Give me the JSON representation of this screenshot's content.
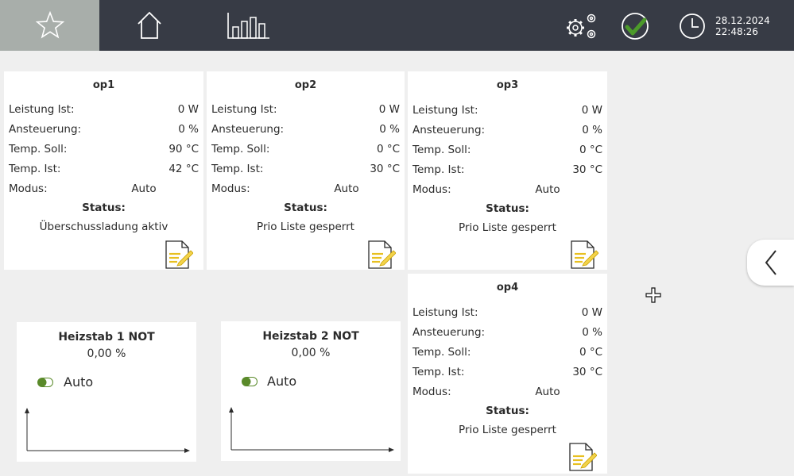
{
  "header": {
    "tabs": [
      {
        "icon": "star-icon",
        "active": true
      },
      {
        "icon": "home-icon",
        "active": false
      },
      {
        "icon": "bar-chart-icon",
        "active": false
      }
    ],
    "date": "28.12.2024",
    "time": "22:48:26",
    "colors": {
      "bar": "#373b45",
      "active_tab": "#a8aeaa",
      "ok_check": "#4c9a2a"
    }
  },
  "labels": {
    "leistung": "Leistung Ist:",
    "ansteuerung": "Ansteuerung:",
    "temp_soll": "Temp. Soll:",
    "temp_ist": "Temp. Ist:",
    "modus": "Modus:",
    "status": "Status:"
  },
  "devices": [
    {
      "name": "op1",
      "leistung": "0 W",
      "ansteuerung": "0 %",
      "temp_soll": "90 °C",
      "temp_ist": "42 °C",
      "modus": "Auto",
      "status": "Überschussladung aktiv"
    },
    {
      "name": "op2",
      "leistung": "0 W",
      "ansteuerung": "0 %",
      "temp_soll": "0 °C",
      "temp_ist": "30 °C",
      "modus": "Auto",
      "status": "Prio Liste gesperrt"
    },
    {
      "name": "op3",
      "leistung": "0 W",
      "ansteuerung": "0 %",
      "temp_soll": "0 °C",
      "temp_ist": "30 °C",
      "modus": "Auto",
      "status": "Prio Liste gesperrt"
    },
    {
      "name": "op4",
      "leistung": "0 W",
      "ansteuerung": "0 %",
      "temp_soll": "0 °C",
      "temp_ist": "30 °C",
      "modus": "Auto",
      "status": "Prio Liste gesperrt"
    }
  ],
  "heaters": [
    {
      "name": "Heizstab 1 NOT",
      "value": "0,00 %",
      "mode": "Auto"
    },
    {
      "name": "Heizstab 2 NOT",
      "value": "0,00 %",
      "mode": "Auto"
    }
  ],
  "toggle_color": "#5a8a2a"
}
